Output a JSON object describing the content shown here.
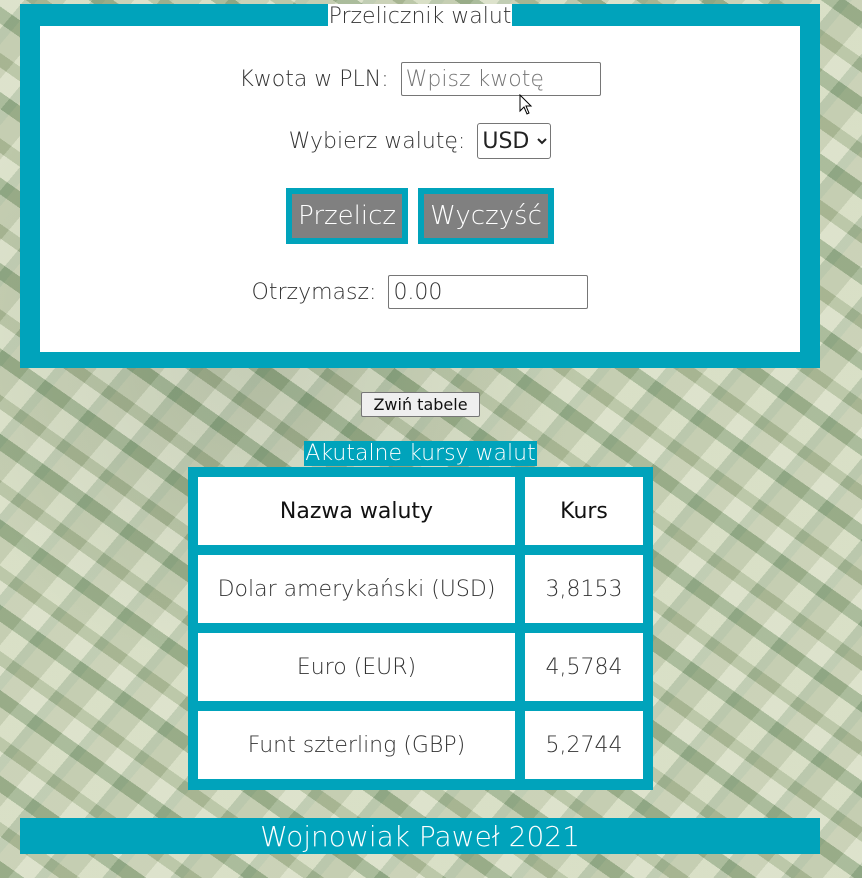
{
  "converter": {
    "legend": "Przelicznik walut",
    "amount_label": "Kwota w PLN:",
    "amount_placeholder": "Wpisz kwotę",
    "amount_value": "",
    "currency_label": "Wybierz walutę:",
    "currency_selected": "USD",
    "calculate_label": "Przelicz",
    "clear_label": "Wyczyść",
    "result_label": "Otrzymasz:",
    "result_value": "0.00"
  },
  "toggle_label": "Zwiń tabele",
  "rates": {
    "legend": "Akutalne kursy walut",
    "headers": [
      "Nazwa waluty",
      "Kurs"
    ],
    "rows": [
      {
        "name": "Dolar amerykański (USD)",
        "rate": "3,8153"
      },
      {
        "name": "Euro (EUR)",
        "rate": "4,5784"
      },
      {
        "name": "Funt szterling (GBP)",
        "rate": "5,2744"
      }
    ]
  },
  "footer": "Wojnowiak Paweł 2021",
  "colors": {
    "accent": "#00a3bb",
    "button_bg": "#808080"
  },
  "icons": {
    "cursor": "mouse-pointer-icon"
  }
}
